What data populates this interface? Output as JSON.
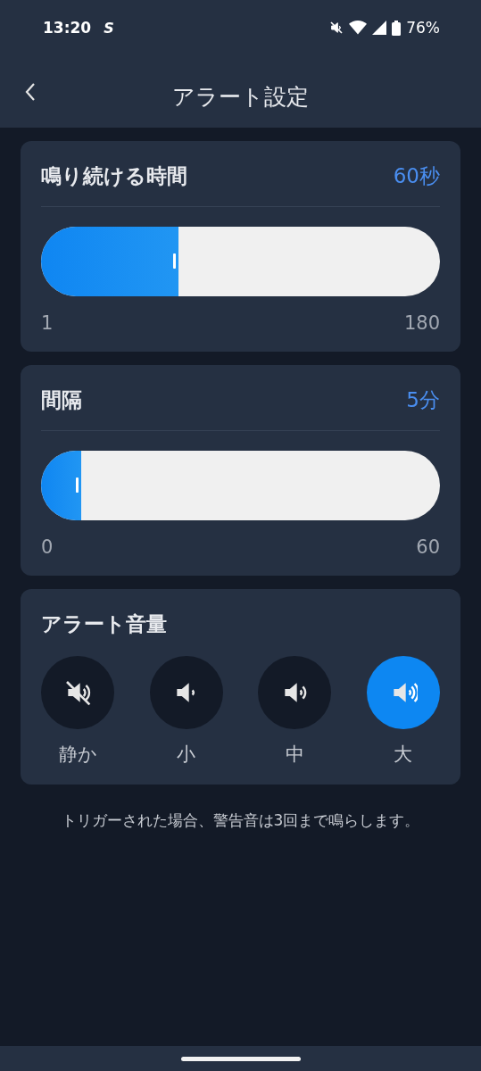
{
  "status_bar": {
    "time": "13:20",
    "notification": "S",
    "battery": "76%"
  },
  "header": {
    "title": "アラート設定"
  },
  "sliders": [
    {
      "title": "鳴り続ける時間",
      "value": "60秒",
      "level": 0.345,
      "min": "1",
      "max": "180"
    },
    {
      "title": "間隔",
      "value": "5分",
      "level": 0.1,
      "min": "0",
      "max": "60"
    }
  ],
  "volume": {
    "title": "アラート音量",
    "options": [
      {
        "kind": "mute",
        "label": "静か",
        "selected": false
      },
      {
        "kind": "low",
        "label": "小",
        "selected": false
      },
      {
        "kind": "mid",
        "label": "中",
        "selected": false
      },
      {
        "kind": "high",
        "label": "大",
        "selected": true
      }
    ]
  },
  "note": "トリガーされた場合、警告音は3回まで鳴らします。"
}
